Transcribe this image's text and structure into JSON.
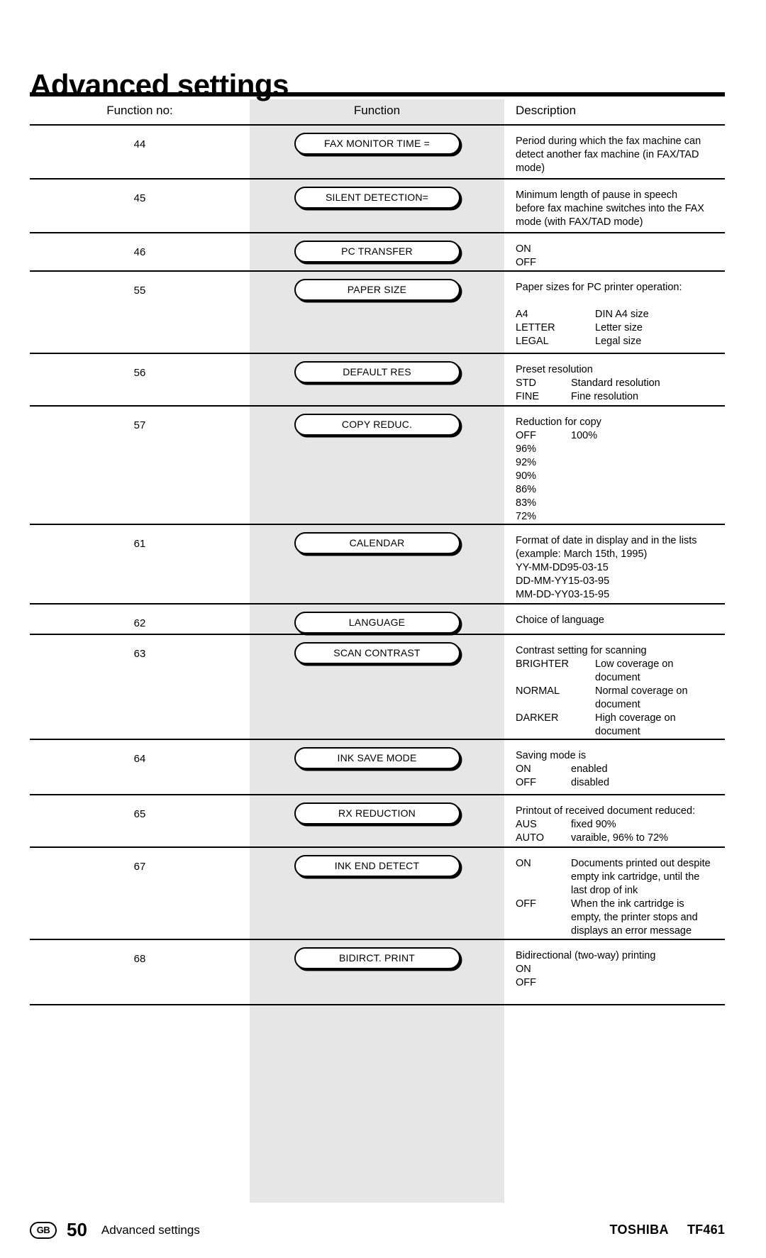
{
  "page": {
    "title": "Advanced settings"
  },
  "table": {
    "headers": {
      "function_no": "Function no:",
      "function": "Function",
      "description": "Description"
    },
    "rows": [
      {
        "no": "44",
        "button": "FAX MONITOR TIME =",
        "desc_lines": [
          "Period during which the fax machine can",
          "detect another fax machine (in FAX/TAD",
          "mode)"
        ]
      },
      {
        "no": "45",
        "button": "SILENT DETECTION=",
        "desc_lines": [
          "Minimum length of pause in speech",
          "before fax machine switches into the FAX",
          "mode (with FAX/TAD mode)"
        ]
      },
      {
        "no": "46",
        "button": "PC TRANSFER",
        "desc_lines": [
          "ON",
          "OFF"
        ]
      },
      {
        "no": "55",
        "button": "PAPER SIZE",
        "desc_intro": "Paper sizes for PC printer operation:",
        "pairs": [
          {
            "key": "A4",
            "value": "DIN A4 size"
          },
          {
            "key": "LETTER",
            "value": "Letter size"
          },
          {
            "key": "LEGAL",
            "value": "Legal size"
          }
        ]
      },
      {
        "no": "56",
        "button": "DEFAULT RES",
        "desc_intro": "Preset resolution",
        "pairs": [
          {
            "key": "STD",
            "value": "Standard resolution"
          },
          {
            "key": "FINE",
            "value": "Fine resolution"
          }
        ]
      },
      {
        "no": "57",
        "button": "COPY REDUC.",
        "desc_intro": "Reduction for copy",
        "pairs": [
          {
            "key": "OFF",
            "value": "100%"
          },
          {
            "key": "96%",
            "value": ""
          },
          {
            "key": "92%",
            "value": ""
          },
          {
            "key": "90%",
            "value": ""
          },
          {
            "key": "86%",
            "value": ""
          },
          {
            "key": "83%",
            "value": ""
          },
          {
            "key": "72%",
            "value": ""
          }
        ]
      },
      {
        "no": "61",
        "button": "CALENDAR",
        "desc_lines": [
          "Format of date in display and in the lists",
          "(example: March 15th, 1995)",
          "YY-MM-DD95-03-15",
          "DD-MM-YY15-03-95",
          "MM-DD-YY03-15-95"
        ]
      },
      {
        "no": "62",
        "button": "LANGUAGE",
        "desc_lines": [
          "Choice of language"
        ]
      },
      {
        "no": "63",
        "button": "SCAN CONTRAST",
        "desc_intro": "Contrast setting for scanning",
        "pairs": [
          {
            "key": "BRIGHTER",
            "value": "Low coverage on",
            "cont": "document"
          },
          {
            "key": "NORMAL",
            "value": "Normal coverage on",
            "cont": "document"
          },
          {
            "key": "DARKER",
            "value": "High coverage on",
            "cont": "document"
          }
        ]
      },
      {
        "no": "64",
        "button": "INK SAVE MODE",
        "desc_intro": "Saving mode is",
        "pairs": [
          {
            "key": "ON",
            "value": "enabled"
          },
          {
            "key": "OFF",
            "value": "disabled"
          }
        ]
      },
      {
        "no": "65",
        "button": "RX REDUCTION",
        "desc_intro": "Printout of received document reduced:",
        "pairs": [
          {
            "key": "AUS",
            "value": "fixed 90%"
          },
          {
            "key": "AUTO",
            "value": "varaible, 96% to 72%"
          }
        ]
      },
      {
        "no": "67",
        "button": "INK END DETECT",
        "pairs": [
          {
            "key": "ON",
            "value": "Documents printed out despite",
            "cont2": [
              "empty ink cartridge, until the",
              "last drop of ink"
            ]
          },
          {
            "key": "OFF",
            "value": "When the ink cartridge is",
            "cont2": [
              "empty, the printer stops and",
              "displays an error message"
            ]
          }
        ]
      },
      {
        "no": "68",
        "button": "BIDIRCT. PRINT",
        "desc_lines": [
          "Bidirectional (two-way) printing",
          "ON",
          "OFF"
        ]
      }
    ]
  },
  "footer": {
    "region_badge": "GB",
    "page_number": "50",
    "section_label": "Advanced settings",
    "brand": "TOSHIBA",
    "model": "TF461"
  }
}
